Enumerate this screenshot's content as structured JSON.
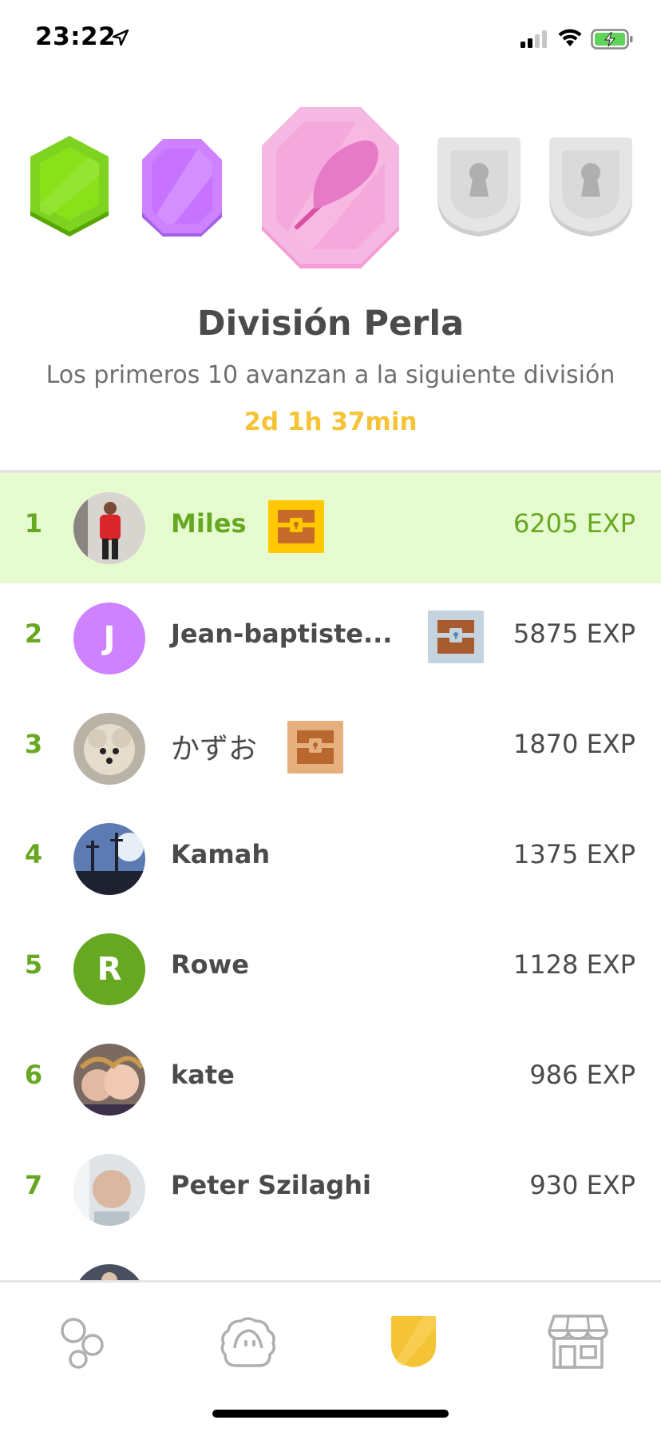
{
  "status_bar": {
    "time": "23:22",
    "icons": [
      "location-arrow-icon",
      "signal-icon",
      "wifi-icon",
      "battery-charging-icon"
    ]
  },
  "league": {
    "badges": [
      {
        "name": "emerald-league-badge-icon",
        "color": "#7ed321"
      },
      {
        "name": "amethyst-league-badge-icon",
        "color": "#ce82ff"
      },
      {
        "name": "pearl-league-badge-icon",
        "color": "#f5a3d9",
        "current": true
      },
      {
        "name": "locked-league-badge-icon",
        "color": "#e0e0e0"
      },
      {
        "name": "locked-league-badge-icon",
        "color": "#e0e0e0"
      }
    ],
    "title": "División Perla",
    "subtitle": "Los primeros 10 avanzan a la siguiente división",
    "timer": "2d 1h 37min"
  },
  "leaderboard": {
    "rows": [
      {
        "rank": "1",
        "name": "Miles",
        "xp": "6205 EXP",
        "chest": "gold",
        "avatar": "photo",
        "highlight": true
      },
      {
        "rank": "2",
        "name": "Jean-baptiste...",
        "xp": "5875 EXP",
        "chest": "silver",
        "avatar": "letter",
        "letter": "J",
        "avatar_color": "#ce82ff"
      },
      {
        "rank": "3",
        "name": "かずお",
        "xp": "1870 EXP",
        "chest": "bronze",
        "avatar": "photo"
      },
      {
        "rank": "4",
        "name": "Kamah",
        "xp": "1375 EXP",
        "chest": "",
        "avatar": "photo"
      },
      {
        "rank": "5",
        "name": "Rowe",
        "xp": "1128 EXP",
        "chest": "",
        "avatar": "letter",
        "letter": "R",
        "avatar_color": "#66a821"
      },
      {
        "rank": "6",
        "name": "kate",
        "xp": "986 EXP",
        "chest": "",
        "avatar": "photo"
      },
      {
        "rank": "7",
        "name": "Peter Szilaghi",
        "xp": "930 EXP",
        "chest": "",
        "avatar": "photo"
      }
    ]
  },
  "bottom_nav": {
    "items": [
      {
        "name": "learn-tab-icon",
        "active": false
      },
      {
        "name": "profile-tab-icon",
        "active": false
      },
      {
        "name": "leagues-tab-icon",
        "active": true
      },
      {
        "name": "shop-tab-icon",
        "active": false
      }
    ]
  },
  "colors": {
    "accent_green": "#66a821",
    "highlight_bg": "#e6fcd0",
    "timer_yellow": "#f5c336",
    "text_dark": "#4b4b4b"
  }
}
